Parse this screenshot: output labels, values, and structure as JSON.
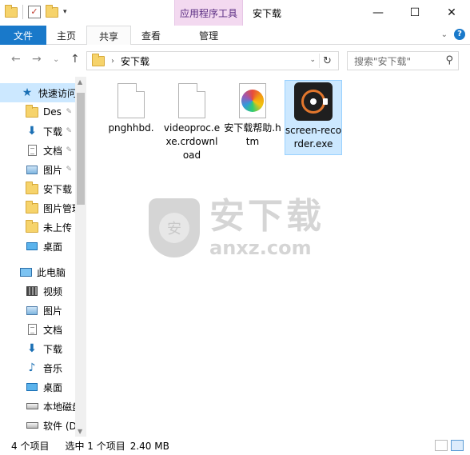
{
  "titlebar": {
    "context_group": "应用程序工具",
    "title": "安下载",
    "minimize": "—",
    "maximize": "☐",
    "close": "✕",
    "qat_dropdown": "▾"
  },
  "ribbon": {
    "tabs": [
      "文件",
      "主页",
      "共享",
      "查看",
      "管理"
    ],
    "collapse": "⌄",
    "help": "?"
  },
  "nav": {
    "back": "←",
    "forward": "→",
    "recent": "⌄",
    "up": "↑",
    "breadcrumb_sep": "›",
    "breadcrumb": "安下载",
    "address_dropdown": "⌄",
    "refresh": "↻",
    "search_placeholder": "搜索\"安下载\"",
    "search_icon": "⚲"
  },
  "sidebar": {
    "items": [
      {
        "label": "快速访问",
        "icon": "star-icon"
      },
      {
        "label": "Des",
        "icon": "folder-icon",
        "pinned": true
      },
      {
        "label": "下载",
        "icon": "download-icon",
        "pinned": true
      },
      {
        "label": "文档",
        "icon": "document-icon",
        "pinned": true
      },
      {
        "label": "图片",
        "icon": "picture-icon",
        "pinned": true
      },
      {
        "label": "安下载",
        "icon": "folder-icon"
      },
      {
        "label": "图片管理",
        "icon": "folder-icon"
      },
      {
        "label": "未上传",
        "icon": "folder-icon"
      },
      {
        "label": "桌面",
        "icon": "desktop-icon"
      },
      {
        "label": "此电脑",
        "icon": "computer-icon"
      },
      {
        "label": "视频",
        "icon": "video-icon"
      },
      {
        "label": "图片",
        "icon": "picture-icon"
      },
      {
        "label": "文档",
        "icon": "document-icon"
      },
      {
        "label": "下载",
        "icon": "download-icon"
      },
      {
        "label": "音乐",
        "icon": "music-icon"
      },
      {
        "label": "桌面",
        "icon": "desktop-icon"
      },
      {
        "label": "本地磁盘",
        "icon": "drive-icon"
      },
      {
        "label": "软件 (D",
        "icon": "drive-icon"
      }
    ],
    "pin_glyph": "📌",
    "scroll_up": "▲",
    "scroll_down": "▼"
  },
  "files": [
    {
      "name": "pnghhbd.",
      "icon": "blank-file-icon"
    },
    {
      "name": "videoproc.exe.crdownload",
      "icon": "blank-file-icon"
    },
    {
      "name": "安下载帮助.htm",
      "icon": "htm-file-icon"
    },
    {
      "name": "screen-recorder.exe",
      "icon": "screen-recorder-app-icon",
      "selected": true
    }
  ],
  "watermark": {
    "shield_char": "安",
    "cn": "安下载",
    "en": "anxz.com"
  },
  "status": {
    "item_count": "4 个项目",
    "selected": "选中 1 个项目",
    "size": "2.40 MB"
  }
}
